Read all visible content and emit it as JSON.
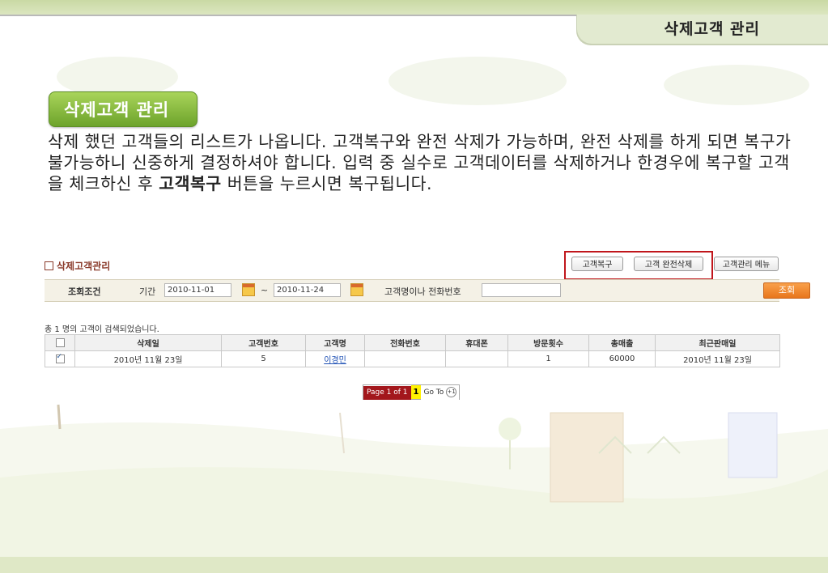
{
  "header": {
    "title": "삭제고객 관리"
  },
  "section": {
    "badge": "삭제고객 관리",
    "desc_part1": "삭제 했던 고객들의 리스트가 나옵니다. 고객복구와 완전 삭제가 가능하며, 완전 삭제를 하게 되면 복구가 불가능하니 신중하게 결정하셔야 합니다. 입력 중 실수로 고객데이터를 삭제하거나 한경우에 복구할 고객을 체크하신 후 ",
    "desc_bold": "고객복구",
    "desc_part2": " 버튼을 누르시면 복구됩니다."
  },
  "panel": {
    "title": "삭제고객관리",
    "restore_button": "고객복구",
    "delete_button": "고객 완전삭제",
    "menu_button": "고객관리 메뉴"
  },
  "search": {
    "label": "조회조건",
    "period_label": "기간",
    "date_from": "2010-11-01",
    "tilde": "~",
    "date_to": "2010-11-24",
    "keyword_label": "고객명이나 전화번호",
    "keyword_value": "",
    "search_button": "조회"
  },
  "result_count": "총 1 명의 고객이 검색되었습니다.",
  "table": {
    "headers": [
      "",
      "삭제일",
      "고객번호",
      "고객명",
      "전화번호",
      "휴대폰",
      "방문횟수",
      "총매출",
      "최근판매일"
    ],
    "rows": [
      {
        "checked": true,
        "deleted_date": "2010년 11월 23일",
        "customer_no": "5",
        "name": "이경민",
        "phone": "",
        "mobile": "",
        "visits": "1",
        "sales": "60000",
        "last_sale": "2010년 11월 23일"
      }
    ]
  },
  "pager": {
    "page_label": "Page 1 of 1",
    "current": "1",
    "goto_label": "Go To",
    "goto_icon": "+1"
  },
  "colors": {
    "badge_green": "#6da32b",
    "panel_title": "#8a3a2a",
    "highlight_red": "#c0161b",
    "search_orange": "#e8761c",
    "pager_red": "#a3171c"
  }
}
